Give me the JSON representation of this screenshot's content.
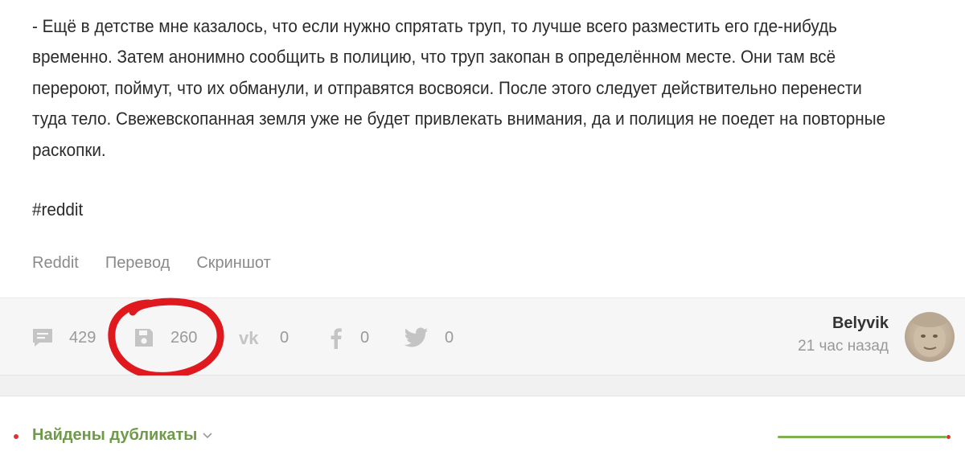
{
  "story": {
    "paragraph": "- Ещё в детстве мне казалось, что если нужно спрятать труп, то лучше всего разместить его где-нибудь временно. Затем анонимно сообщить в полицию, что труп закопан в определённом месте. Они там всё перероют, поймут, что их обманули, и отправятся восвояси. После этого следует действительно перенести туда тело. Свежевскопанная земля уже не будет привлекать внимания, да и полиция не поедет на повторные раскопки.",
    "hashtag": "#reddit",
    "tags": [
      "Reddit",
      "Перевод",
      "Скриншот"
    ]
  },
  "stats": {
    "comments": "429",
    "saves": "260",
    "vk": "0",
    "facebook": "0",
    "twitter": "0"
  },
  "author": {
    "name": "Belyvik",
    "time": "21 час назад"
  },
  "duplicates": {
    "label": "Найдены дубликаты"
  },
  "colors": {
    "annotation": "#e0191f",
    "duplicates_text": "#6e9a4a",
    "bar": "#7bb24e",
    "dot": "#d8352f"
  }
}
